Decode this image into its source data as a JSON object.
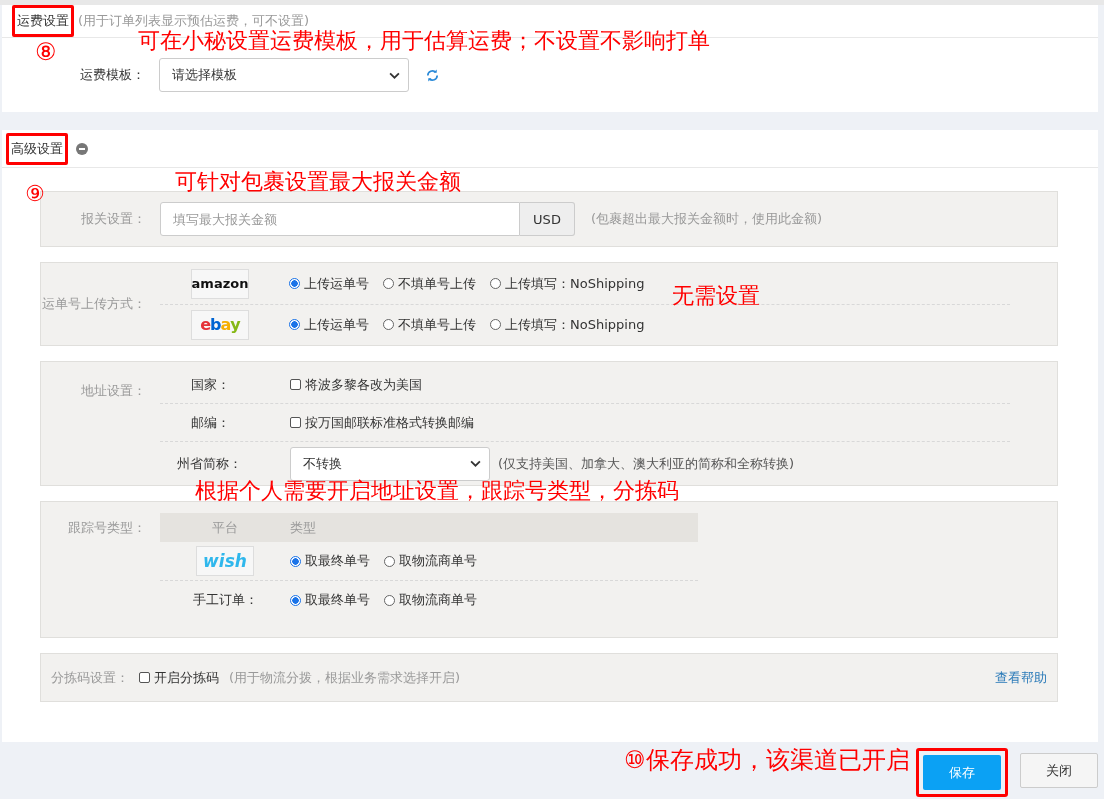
{
  "freight_section": {
    "title": "运费设置",
    "title_highlighted": true,
    "hint": "(用于订单列表显示预估运费，可不设置)",
    "template_label": "运费模板：",
    "template_select": "请选择模板"
  },
  "advanced_section": {
    "title": "高级设置",
    "title_highlighted": true,
    "customs": {
      "label": "报关设置：",
      "placeholder": "填写最大报关金额",
      "currency": "USD",
      "hint": "(包裹超出最大报关金额时，使用此金额)"
    },
    "upload": {
      "label": "运单号上传方式：",
      "rows": [
        {
          "logo": "amazon",
          "kind": "amazon",
          "options": [
            {
              "label": "上传运单号",
              "selected": true
            },
            {
              "label": "不填单号上传",
              "selected": false
            },
            {
              "label": "上传填写：NoShipping",
              "selected": false
            }
          ]
        },
        {
          "logo": "ebay",
          "kind": "ebay",
          "options": [
            {
              "label": "上传运单号",
              "selected": true
            },
            {
              "label": "不填单号上传",
              "selected": false
            },
            {
              "label": "上传填写：NoShipping",
              "selected": false
            }
          ]
        }
      ]
    },
    "address": {
      "label": "地址设置：",
      "rows": [
        {
          "kind": "checkbox",
          "label": "国家：",
          "text": "将波多黎各改为美国",
          "checked": false
        },
        {
          "kind": "checkbox",
          "label": "邮编：",
          "text": "按万国邮联标准格式转换邮编",
          "checked": false
        },
        {
          "kind": "select",
          "label": "州省简称：",
          "value": "不转换",
          "hint": "(仅支持美国、加拿大、澳大利亚的简称和全称转换)"
        }
      ]
    },
    "tracking": {
      "label": "跟踪号类型：",
      "columns": [
        "平台",
        "类型"
      ],
      "rows": [
        {
          "kind": "logo",
          "logo": "wish",
          "options": [
            {
              "label": "取最终单号",
              "selected": true
            },
            {
              "label": "取物流商单号",
              "selected": false
            }
          ]
        },
        {
          "kind": "text",
          "name": "手工订单：",
          "options": [
            {
              "label": "取最终单号",
              "selected": true
            },
            {
              "label": "取物流商单号",
              "selected": false
            }
          ]
        }
      ]
    },
    "sorting": {
      "label": "分拣码设置：",
      "checkbox": "开启分拣码",
      "checked": false,
      "hint": "(用于物流分拨，根据业务需求选择开启)",
      "link": "查看帮助"
    }
  },
  "footer": {
    "save": "保存",
    "save_highlighted": true,
    "close": "关闭"
  },
  "annotations": [
    {
      "text": "⑧"
    },
    {
      "text": "可在小秘设置运费模板，用于估算运费；不设置不影响打单"
    },
    {
      "text": "⑨"
    },
    {
      "text": "可针对包裹设置最大报关金额"
    },
    {
      "text": "无需设置"
    },
    {
      "text": "根据个人需要开启地址设置，跟踪号类型，分拣码"
    },
    {
      "text": "⑩保存成功，该渠道已开启"
    }
  ]
}
